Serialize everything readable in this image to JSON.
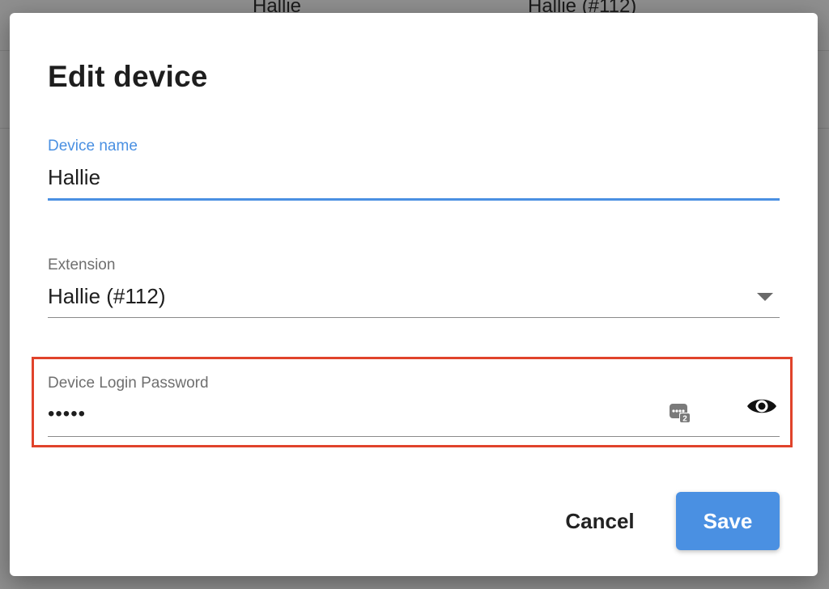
{
  "background": {
    "row_name": "Hallie",
    "row_extension": "Hallie (#112)"
  },
  "dialog": {
    "title": "Edit device",
    "device_name": {
      "label": "Device name",
      "value": "Hallie"
    },
    "extension": {
      "label": "Extension",
      "value": "Hallie (#112)"
    },
    "password": {
      "label": "Device Login Password",
      "value": "•••••"
    },
    "buttons": {
      "cancel": "Cancel",
      "save": "Save"
    }
  },
  "colors": {
    "accent": "#4a90e2",
    "highlight": "#e0432b"
  }
}
